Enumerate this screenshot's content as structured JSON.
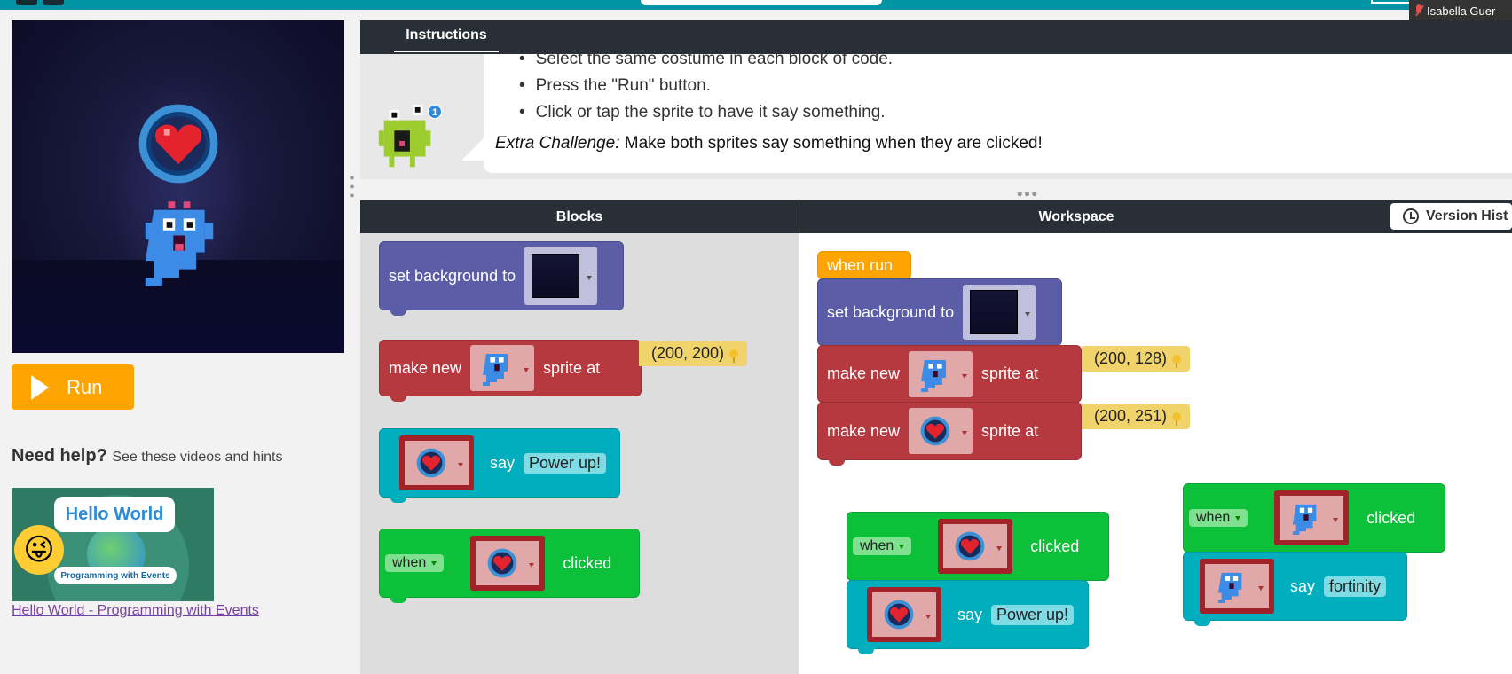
{
  "user": {
    "name": "Isabella Guer"
  },
  "run_button": {
    "label": "Run"
  },
  "help": {
    "title": "Need help?",
    "subtitle": "See these videos and hints"
  },
  "video": {
    "bubble_title": "Hello World",
    "bubble_sub": "Programming with Events",
    "link_text": "Hello World - Programming with Events"
  },
  "instructions": {
    "tab": "Instructions",
    "bullets": [
      "Select the same costume in each block of code.",
      "Press the \"Run\" button.",
      "Click or tap the sprite to have it say something."
    ],
    "extra_label": "Extra Challenge:",
    "extra_text": "Make both sprites say something when they are clicked!",
    "notification_count": "1"
  },
  "panels": {
    "blocks": "Blocks",
    "workspace": "Workspace",
    "version_history": "Version Hist"
  },
  "toolbox": {
    "set_background": "set background to",
    "make_new": "make new",
    "sprite_at": "sprite at",
    "coord": "(200, 200)",
    "say": "say",
    "say_text": "Power up!",
    "when": "when",
    "clicked": "clicked"
  },
  "workspace": {
    "when_run": "when run",
    "set_background": "set background to",
    "make_new": "make new",
    "sprite_at": "sprite at",
    "coord1": "(200, 128)",
    "coord2": "(200, 251)",
    "when": "when",
    "clicked": "clicked",
    "say": "say",
    "heart_say_text": "Power up!",
    "ghost_say_text": "fortinity"
  },
  "colors": {
    "run": "#ffa400",
    "header": "#292f36",
    "teal": "#0094a5"
  }
}
